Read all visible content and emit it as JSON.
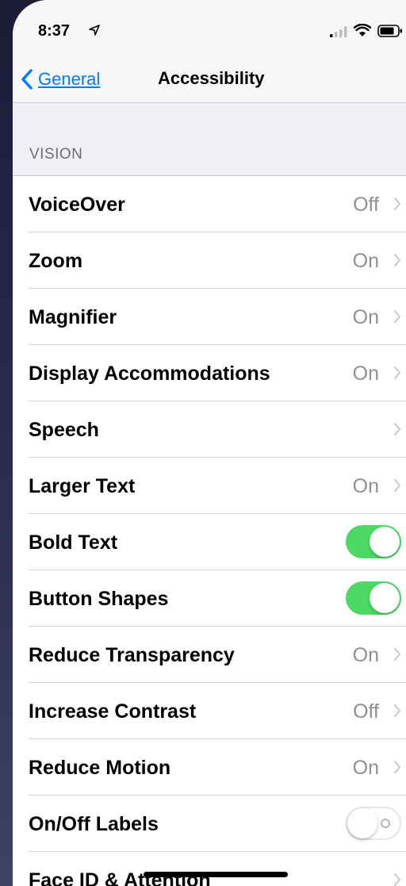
{
  "status_bar": {
    "time": "8:37",
    "icons": [
      "location-arrow-icon",
      "cellular-signal-icon",
      "wifi-icon",
      "battery-icon"
    ]
  },
  "nav": {
    "back_label": "General",
    "title": "Accessibility"
  },
  "section": {
    "header": "VISION"
  },
  "rows": [
    {
      "label": "VoiceOver",
      "value": "Off",
      "kind": "chevron"
    },
    {
      "label": "Zoom",
      "value": "On",
      "kind": "chevron"
    },
    {
      "label": "Magnifier",
      "value": "On",
      "kind": "chevron"
    },
    {
      "label": "Display Accommodations",
      "value": "On",
      "kind": "chevron"
    },
    {
      "label": "Speech",
      "value": "",
      "kind": "chevron"
    },
    {
      "label": "Larger Text",
      "value": "On",
      "kind": "chevron"
    },
    {
      "label": "Bold Text",
      "value": "",
      "kind": "toggle",
      "toggle_state": "on"
    },
    {
      "label": "Button Shapes",
      "value": "",
      "kind": "toggle",
      "toggle_state": "on"
    },
    {
      "label": "Reduce Transparency",
      "value": "On",
      "kind": "chevron"
    },
    {
      "label": "Increase Contrast",
      "value": "Off",
      "kind": "chevron"
    },
    {
      "label": "Reduce Motion",
      "value": "On",
      "kind": "chevron"
    },
    {
      "label": "On/Off Labels",
      "value": "",
      "kind": "toggle",
      "toggle_state": "off"
    },
    {
      "label": "Face ID & Attention",
      "value": "",
      "kind": "chevron"
    }
  ],
  "colors": {
    "accent": "#007aff",
    "toggle_on": "#4cd964",
    "secondary_text": "#8e8e93",
    "background": "#efeff4"
  }
}
